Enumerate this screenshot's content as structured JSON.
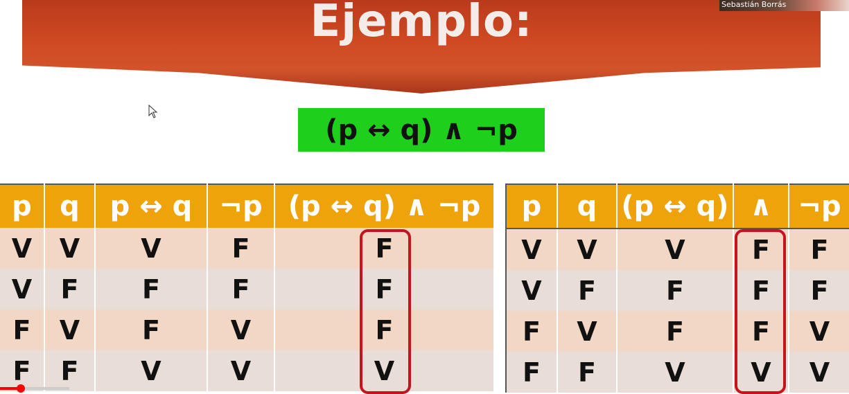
{
  "slide": {
    "title": "Ejemplo:",
    "formula": "(p ↔ q) ∧ ¬p"
  },
  "webcam": {
    "name": "Sebastián Borrás"
  },
  "table_left": {
    "headers": [
      "p",
      "q",
      "p ↔ q",
      "¬p",
      "(p ↔ q) ∧ ¬p"
    ],
    "rows": [
      [
        "V",
        "V",
        "V",
        "F",
        "F"
      ],
      [
        "V",
        "F",
        "F",
        "F",
        "F"
      ],
      [
        "F",
        "V",
        "F",
        "V",
        "F"
      ],
      [
        "F",
        "F",
        "V",
        "V",
        "V"
      ]
    ]
  },
  "table_right": {
    "headers": [
      "p",
      "q",
      "(p ↔ q)",
      "∧",
      "¬p"
    ],
    "rows": [
      [
        "V",
        "V",
        "V",
        "F",
        "F"
      ],
      [
        "V",
        "F",
        "F",
        "F",
        "F"
      ],
      [
        "F",
        "V",
        "F",
        "F",
        "V"
      ],
      [
        "F",
        "F",
        "V",
        "V",
        "V"
      ]
    ]
  },
  "highlight_color": "#c7141c",
  "header_color": "#eea30b",
  "formula_box_color": "#1ed01b",
  "video": {
    "progress_fraction": 0.3
  }
}
